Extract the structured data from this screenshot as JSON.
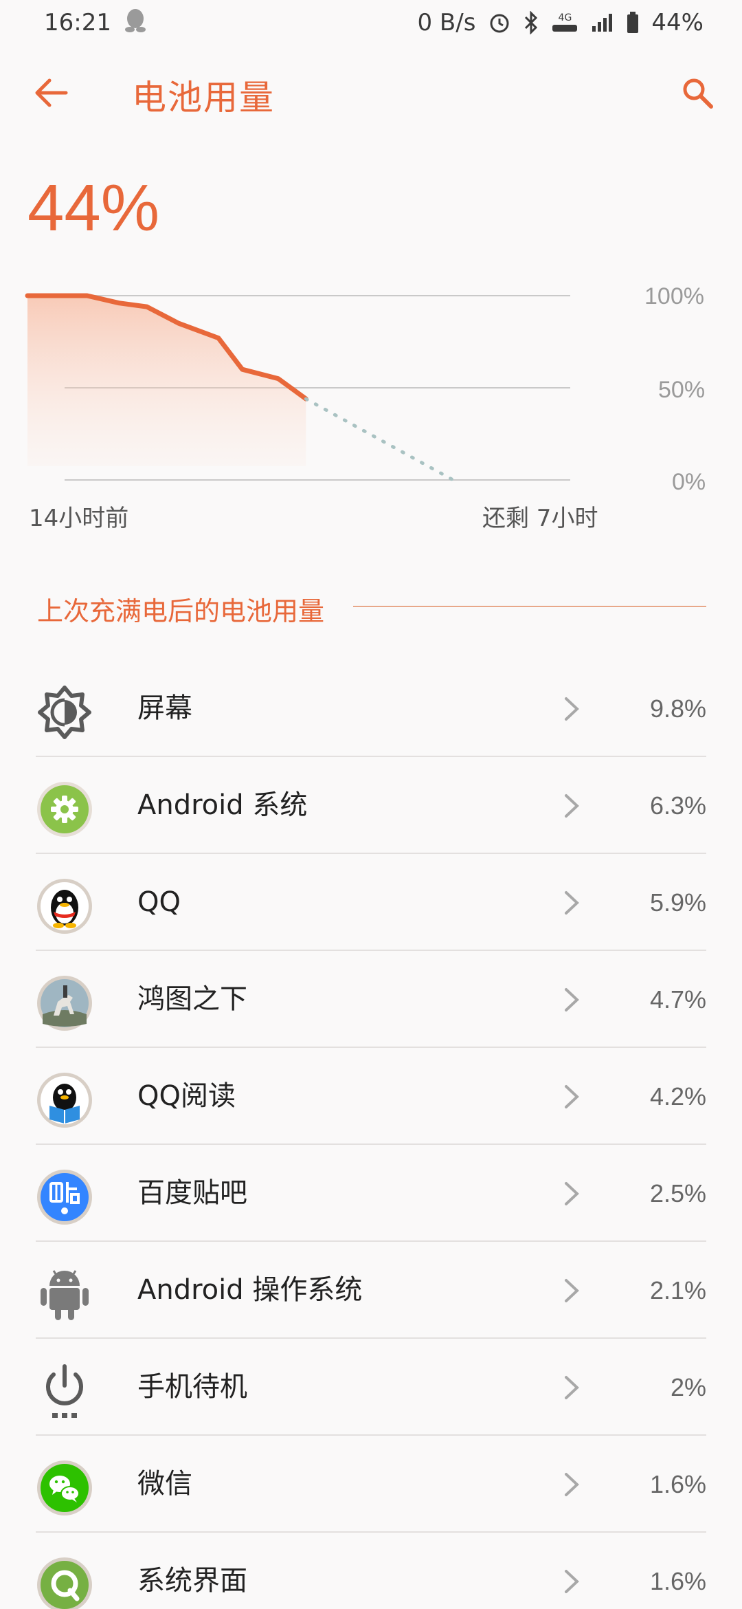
{
  "status_bar": {
    "time": "16:21",
    "speed": "0 B/s",
    "network": "4G",
    "battery": "44%"
  },
  "header": {
    "title": "电池用量",
    "back_icon": "back-arrow-icon",
    "search_icon": "search-icon",
    "accent": "#e8683a"
  },
  "battery_level": "44%",
  "chart": {
    "y_labels": [
      "100%",
      "50%",
      "0%"
    ],
    "start_label": "14小时前",
    "end_label": "还剩 7小时"
  },
  "chart_data": {
    "type": "line",
    "x_label_start": "14小时前",
    "x_label_end": "还剩 7小时",
    "ylim": [
      0,
      100
    ],
    "yticks": [
      "100%",
      "50%",
      "0%"
    ],
    "series": [
      {
        "style": "solid",
        "x": [
          0,
          1.5,
          2.3,
          3.0,
          3.8,
          4.8,
          5.4,
          6.3,
          7.0
        ],
        "y": [
          100,
          100,
          96,
          94,
          85,
          77,
          60,
          55,
          44
        ]
      },
      {
        "style": "dotted",
        "x": [
          7.0,
          10.7
        ],
        "y": [
          44,
          0
        ]
      }
    ]
  },
  "section_title": "上次充满电后的电池用量",
  "usage": [
    {
      "label": "屏幕",
      "value": "9.8%",
      "icon": "screen-brightness-icon"
    },
    {
      "label": "Android 系统",
      "value": "6.3%",
      "icon": "android-system-gear-icon"
    },
    {
      "label": "QQ",
      "value": "5.9%",
      "icon": "qq-penguin-icon"
    },
    {
      "label": "鸿图之下",
      "value": "4.7%",
      "icon": "game-horse-icon"
    },
    {
      "label": "QQ阅读",
      "value": "4.2%",
      "icon": "qq-reader-icon"
    },
    {
      "label": "百度贴吧",
      "value": "2.5%",
      "icon": "baidu-tieba-icon"
    },
    {
      "label": "Android 操作系统",
      "value": "2.1%",
      "icon": "android-robot-icon"
    },
    {
      "label": "手机待机",
      "value": "2%",
      "icon": "power-standby-icon"
    },
    {
      "label": "微信",
      "value": "1.6%",
      "icon": "wechat-icon"
    },
    {
      "label": "系统界面",
      "value": "1.6%",
      "icon": "system-ui-icon"
    }
  ]
}
